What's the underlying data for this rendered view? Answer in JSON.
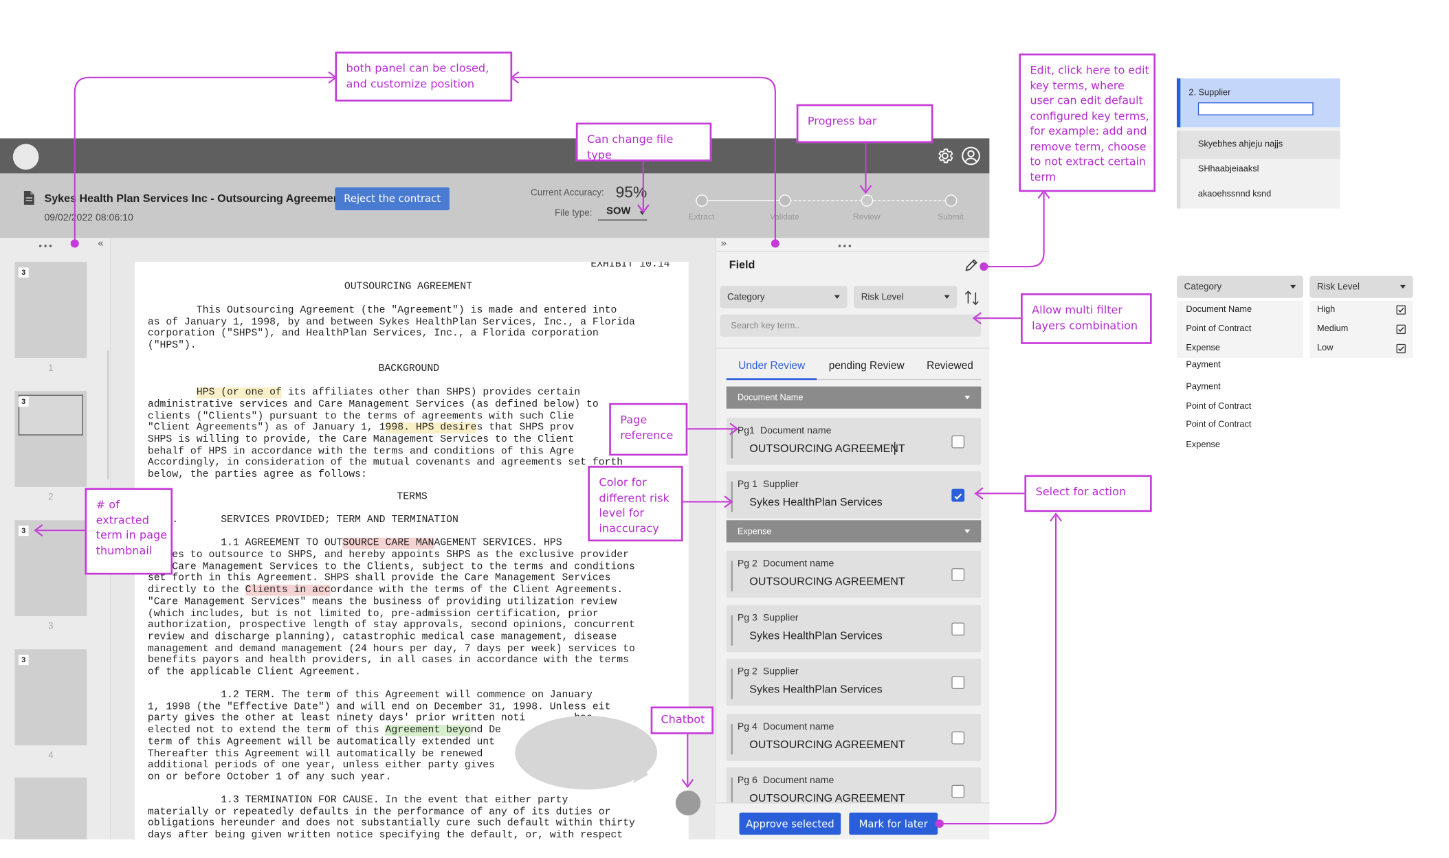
{
  "header": {
    "title": "Sykes Health Plan Services Inc - Outsourcing Agreement",
    "date": "09/02/2022  08:06:10",
    "reject_label": "Reject the contract",
    "accuracy_label": "Current Accuracy:",
    "accuracy_value": "95%",
    "filetype_label": "File type:",
    "filetype_value": "SOW"
  },
  "progress": {
    "steps": [
      "Extract",
      "Validate",
      "Review",
      "Submit"
    ],
    "current_index": 2
  },
  "thumbnails": [
    {
      "page": "1",
      "count": "3"
    },
    {
      "page": "2",
      "count": "3"
    },
    {
      "page": "3",
      "count": "3"
    },
    {
      "page": "4",
      "count": "3"
    }
  ],
  "document": {
    "exhibit": "EXHIBIT 10.14",
    "title": "OUTSOURCING AGREEMENT",
    "p1": [
      "        This Outsourcing Agreement (the \"Agreement\") is made and entered into",
      "as of January 1, 1998, by and between Sykes HealthPlan Services, Inc., a Florida",
      "corporation (\"SHPS\"), and HealthPlan Services, Inc., a Florida corporation",
      "(\"HPS\")."
    ],
    "background": "BACKGROUND",
    "bg_a": "        ",
    "bg_h1": "HPS (or one of",
    "bg_b": " its affiliates other than SHPS) provides certain",
    "bg2": [
      "administrative services and Care Management Services (as defined below) to",
      "clients (\"Clients\") pursuant to the terms of agreements with such Clie"
    ],
    "bg3a": "\"Client Agreements\") as of January 1, 1",
    "bg3h": "998. HPS desire",
    "bg3b": "s that SHPS prov",
    "bg4": [
      "SHPS is willing to provide, the Care Management Services to the Client",
      "behalf of HPS in accordance with the terms and conditions of this Agre",
      "Accordingly, in consideration of the mutual covenants and agreements set forth",
      "below, the parties agree as follows:"
    ],
    "terms": "TERMS",
    "s1": "   1.       SERVICES PROVIDED; TERM AND TERMINATION",
    "s11a": "            1.1 AGREEMENT TO OUT",
    "s11h": "SOURCE CARE MAN",
    "s11b": "AGEMENT SERVICES. HPS",
    "s11c": [
      "    es to outsource to SHPS, and hereby appoints SHPS as the exclusive provider",
      "    Care Management Services to the Clients, subject to the terms and conditions",
      "set forth in this Agreement. SHPS shall provide the Care Management Services"
    ],
    "s11d1": "directly to the ",
    "s11dh": "Clients in acc",
    "s11d2": "ordance with the terms of the Client Agreements.",
    "s11e": [
      "\"Care Management Services\" means the business of providing utilization review",
      "(which includes, but is not limited to, pre-admission certification, prior",
      "authorization, prospective length of stay approvals, second opinions, concurrent",
      "review and discharge planning), catastrophic medical case management, disease",
      "management and demand management (24 hours per day, 7 days per week) services to",
      "benefits payors and health providers, in all cases in accordance with the terms",
      "of the applicable Client Agreement."
    ],
    "s12": [
      "            1.2 TERM. The term of this Agreement will commence on January",
      "1, 1998 (the \"Effective Date\") and will end on December 31, 1998. Unless eit",
      "party gives the other at least ninety days' prior written noti        has"
    ],
    "s12a": "elected not to extend the term of this ",
    "s12h": "Agreement beyo",
    "s12b": "nd De",
    "s12c": [
      "term of this Agreement will be automatically extended unt",
      "Thereafter this Agreement will automatically be renewed",
      "additional periods of one year, unless either party gives             ion",
      "on or before October 1 of any such year."
    ],
    "s13": [
      "            1.3 TERMINATION FOR CAUSE. In the event that either party",
      "materially or repeatedly defaults in the performance of any of its duties or",
      "obligations hereunder and does not substantially cure such default within thirty",
      "days after being given written notice specifying the default, or, with respect"
    ]
  },
  "field_panel": {
    "title": "Field",
    "category_label": "Category",
    "risk_label": "Risk Level",
    "search_placeholder": "Search key term..",
    "tabs": [
      "Under Review",
      "pending Review",
      "Reviewed"
    ],
    "active_tab": 0,
    "groups": [
      {
        "name": "Document Name",
        "items": [
          {
            "page": "Pg1",
            "field": "Document name",
            "value": "OUTSOURCING AGREEMENT",
            "checked": false,
            "editing": true
          },
          {
            "page": "Pg 1",
            "field": "Supplier",
            "value": "Sykes HealthPlan Services",
            "checked": true
          }
        ]
      },
      {
        "name": "Expense",
        "items": [
          {
            "page": "Pg 2",
            "field": "Document name",
            "value": "OUTSOURCING AGREEMENT",
            "checked": false
          },
          {
            "page": "Pg 3",
            "field": "Supplier",
            "value": "Sykes HealthPlan Services",
            "checked": false
          },
          {
            "page": "Pg 2",
            "field": "Supplier",
            "value": "Sykes HealthPlan Services",
            "checked": false
          },
          {
            "page": "Pg 4",
            "field": "Document name",
            "value": "OUTSOURCING AGREEMENT",
            "checked": false
          },
          {
            "page": "Pg 6",
            "field": "Document name",
            "value": "OUTSOURCING AGREEMENT",
            "checked": false
          }
        ]
      }
    ],
    "approve_label": "Approve selected",
    "later_label": "Mark for later"
  },
  "annotations": {
    "panels": "both panel can be closed,\nand customize position",
    "filetype": "Can change file type",
    "progress": "Progress bar",
    "edit": "Edit, click here to edit\nkey terms, where\nuser can edit default\nconfigured key terms,\nfor example: add and\nremove term, choose\nto not extract certain\nterm",
    "multifilter": "Allow multi filter\nlayers combination",
    "pageref": "Page\nreference",
    "color": "Color for\ndifferent risk\nlevel for\ninaccuracy",
    "select": "Select for action",
    "count": "# of\nextracted\nterm in page\nthumbnail",
    "chatbot": "Chatbot"
  },
  "side_edit": {
    "label": "2. Supplier",
    "items": [
      "Skyebhes ahjeju najjs",
      "SHhaabjeiaaksl",
      "akaoehssnnd ksnd"
    ]
  },
  "side_filter": {
    "category_label": "Category",
    "risk_label": "Risk Level",
    "category_items": [
      "Document Name",
      "Point of Contract",
      "Expense",
      "Payment",
      "Payment",
      "Point of Contract",
      "Point of Contract",
      "Expense"
    ],
    "risk_items": [
      "High",
      "Medium",
      "Low"
    ]
  },
  "colors": {
    "accent": "#2b5fd9",
    "annotation": "#c53bd8"
  }
}
